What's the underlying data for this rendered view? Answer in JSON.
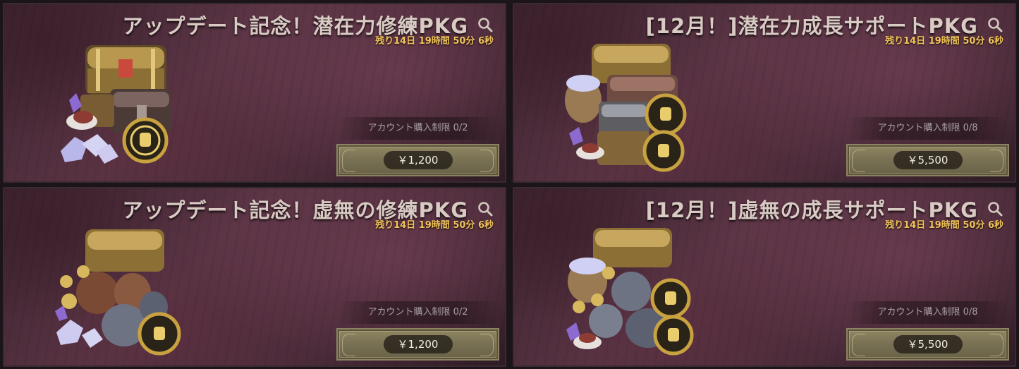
{
  "packages": [
    {
      "title": "アップデート記念！潜在力修練PKG",
      "timer": "残り14日 19時間 50分 6秒",
      "limit": "アカウント購入制限 0/2",
      "price": "￥1,200",
      "icon": "search-icon"
    },
    {
      "title": "[12月！]潜在力成長サポートPKG",
      "timer": "残り14日 19時間 50分 6秒",
      "limit": "アカウント購入制限 0/8",
      "price": "￥5,500",
      "icon": "search-icon"
    },
    {
      "title": "アップデート記念！虚無の修練PKG",
      "timer": "残り14日 19時間 50分 6秒",
      "limit": "アカウント購入制限 0/2",
      "price": "￥1,200",
      "icon": "search-icon"
    },
    {
      "title": "[12月！]虚無の成長サポートPKG",
      "timer": "残り14日 19時間 50分 6秒",
      "limit": "アカウント購入制限 0/8",
      "price": "￥5,500",
      "icon": "search-icon"
    }
  ],
  "colors": {
    "timer": "#f1c35a",
    "title": "#d9cbc4",
    "button": "#7a7254",
    "card_bg": "#4a2b39"
  }
}
